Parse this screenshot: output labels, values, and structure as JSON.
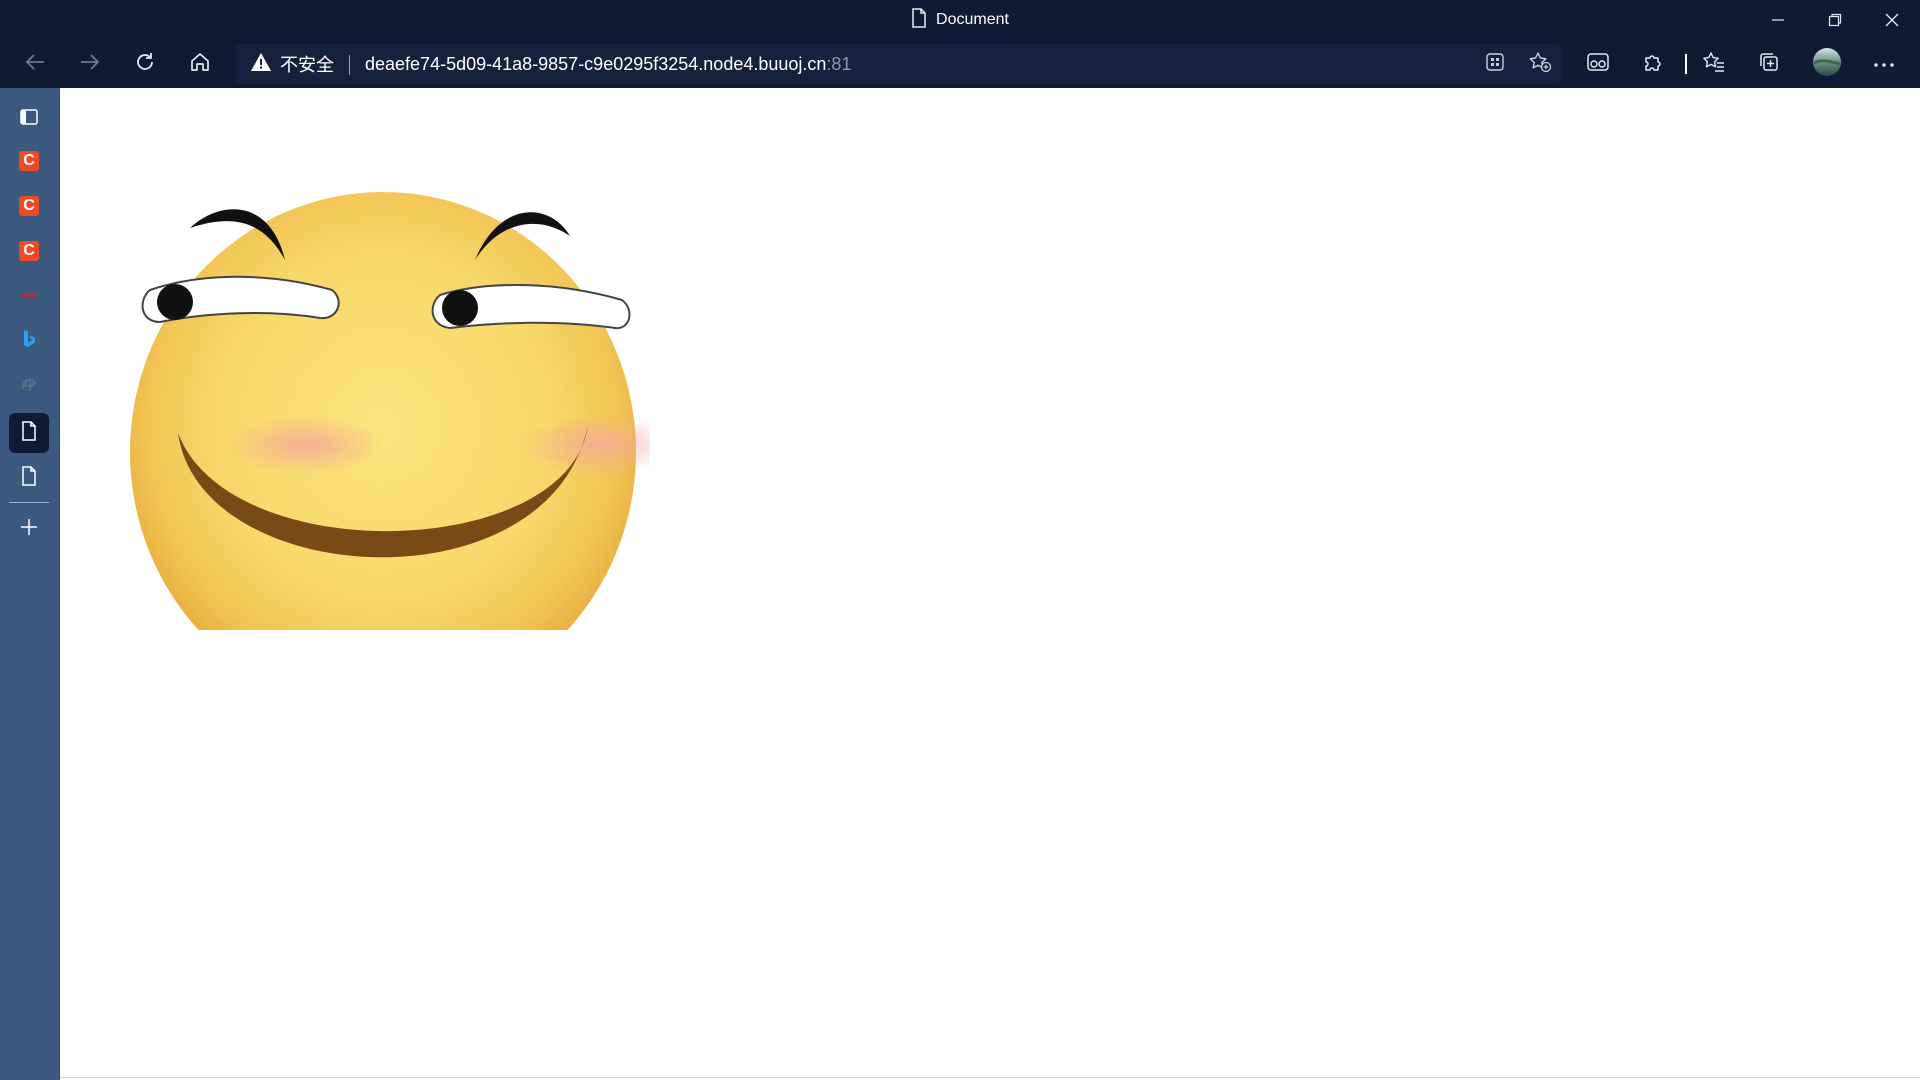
{
  "window": {
    "title": "Document"
  },
  "addressbar": {
    "security_label": "不安全",
    "url_host": "deaefe74-5d09-41a8-9857-c9e0295f3254.node4.buuoj.cn",
    "url_port": ":81"
  },
  "toolbar": {
    "back_icon": "arrow-left-icon",
    "forward_icon": "arrow-right-icon",
    "refresh_icon": "refresh-icon",
    "home_icon": "home-icon"
  },
  "sidebar": {
    "items": [
      {
        "name": "tab-actions-icon"
      },
      {
        "name": "tab-csdn-1",
        "badge": "C"
      },
      {
        "name": "tab-csdn-2",
        "badge": "C"
      },
      {
        "name": "tab-csdn-3",
        "badge": "C"
      },
      {
        "name": "tab-red-site"
      },
      {
        "name": "tab-bing"
      },
      {
        "name": "tab-other-site"
      },
      {
        "name": "tab-document-active"
      },
      {
        "name": "tab-document-2"
      }
    ]
  },
  "content": {
    "image": "smirking-emoji-face"
  },
  "colors": {
    "chrome": "#0f1a33",
    "sidebar": "#3c5a7f",
    "csdn_badge": "#ef4a23",
    "face_yellow": "#f8d86a"
  }
}
